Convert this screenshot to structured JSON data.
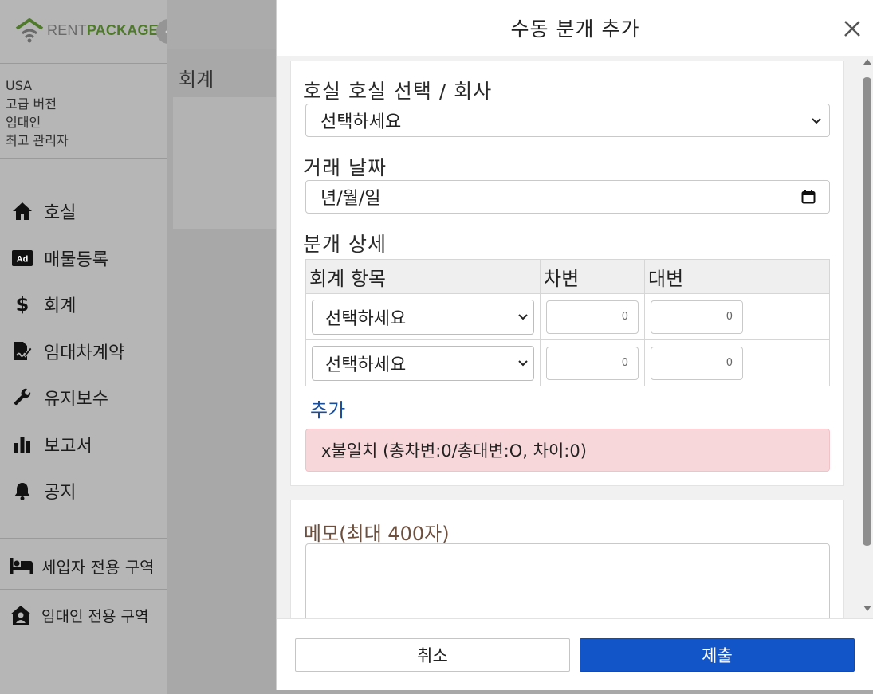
{
  "brand": {
    "rent": "RENT",
    "package": "PACKAGE",
    "accent": "#4f7a2c"
  },
  "user": {
    "country": "USA",
    "plan": "고급 버전",
    "role": "임대인",
    "level": "최고 관리자"
  },
  "nav": {
    "items": [
      {
        "label": "호실",
        "icon": "home-icon"
      },
      {
        "label": "매물등록",
        "icon": "ad-icon"
      },
      {
        "label": "회계",
        "icon": "dollar-icon"
      },
      {
        "label": "임대차계약",
        "icon": "contract-icon"
      },
      {
        "label": "유지보수",
        "icon": "wrench-icon"
      },
      {
        "label": "보고서",
        "icon": "bar-chart-icon"
      },
      {
        "label": "공지",
        "icon": "bell-icon"
      }
    ],
    "tenant_zone": "세입자 전용 구역",
    "landlord_zone": "임대인 전용 구역"
  },
  "main": {
    "title": "회계"
  },
  "modal": {
    "title": "수동 분개 추가",
    "unit_label": "호실 호실 선택 / 회사",
    "unit_select": "선택하세요",
    "date_label": "거래 날짜",
    "date_placeholder": "년/월/일",
    "detail_label": "분개 상세",
    "table": {
      "headers": [
        "회계 항목",
        "차변",
        "대변",
        ""
      ],
      "rows": [
        {
          "account": "선택하세요",
          "debit": "0",
          "credit": "0"
        },
        {
          "account": "선택하세요",
          "debit": "0",
          "credit": "0"
        }
      ]
    },
    "add_label": "추가",
    "alert": "x불일치 (총차변:0/총대변:O, 차이:0)",
    "memo_label": "메모(최대 400자)",
    "cancel_label": "취소",
    "submit_label": "제출",
    "submit_color": "#1255c9",
    "alert_color": "#f8d7da"
  }
}
